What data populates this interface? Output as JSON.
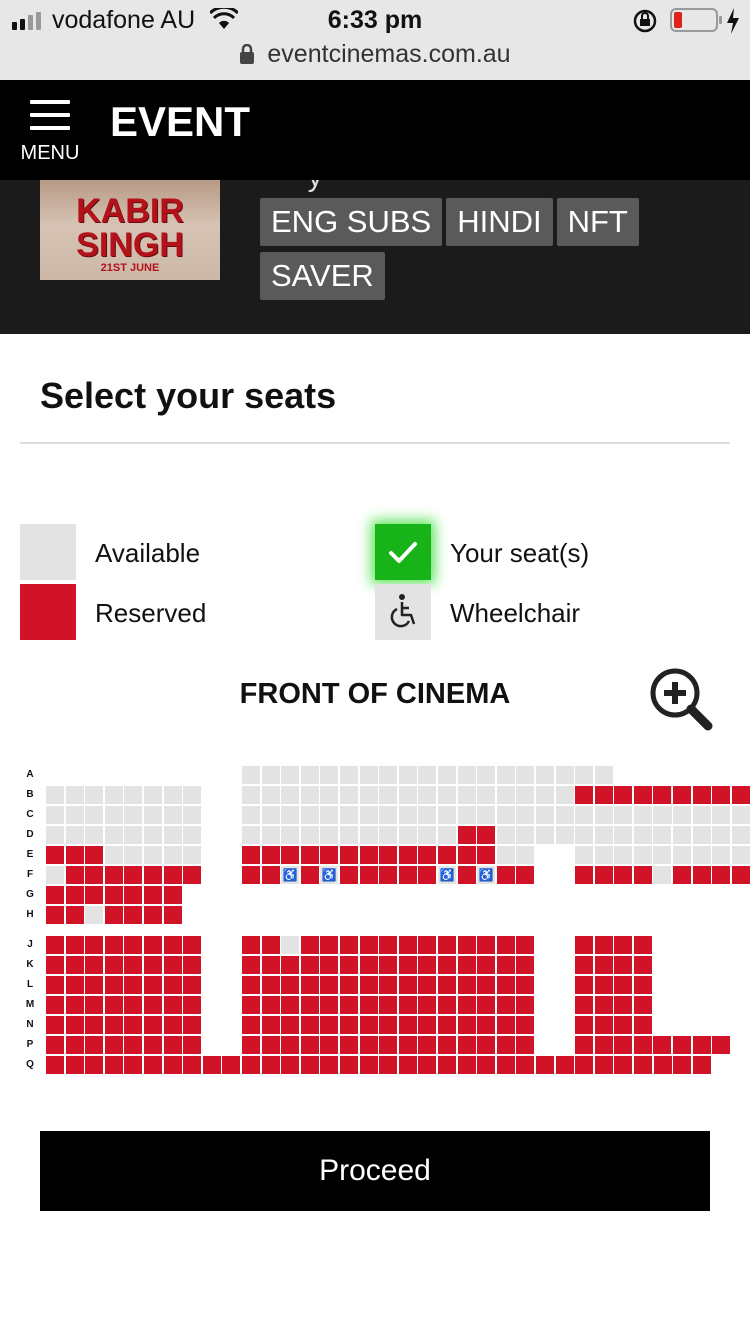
{
  "status_bar": {
    "carrier": "vodafone AU",
    "time": "6:33 pm",
    "url": "eventcinemas.com.au"
  },
  "nav": {
    "menu_label": "MENU",
    "logo": "EVENT"
  },
  "movie": {
    "poster_title_line1": "KABIR",
    "poster_title_line2": "SINGH",
    "poster_date": "21ST JUNE",
    "tags": [
      "ENG SUBS",
      "HINDI",
      "NFT",
      "SAVER"
    ]
  },
  "page": {
    "title": "Select your seats"
  },
  "legend": {
    "available": "Available",
    "your_seats": "Your seat(s)",
    "reserved": "Reserved",
    "wheelchair": "Wheelchair"
  },
  "screen_label": "FRONT OF CINEMA",
  "colors": {
    "reserved": "#d01326",
    "available": "#e3e3e3",
    "selected": "#18b318",
    "header": "#000000"
  },
  "seat_map": {
    "rows": [
      {
        "label": "A",
        "blocks": [
          "",
          "...................",
          ""
        ]
      },
      {
        "label": "B",
        "blocks": [
          "........",
          "..........................",
          "RRRRRRRRR"
        ]
      },
      {
        "label": "C",
        "blocks": [
          "........",
          "..........................",
          "........."
        ]
      },
      {
        "label": "D",
        "blocks": [
          "........",
          "...........RR.......",
          ".........."
        ]
      },
      {
        "label": "E",
        "blocks": [
          "RRR.....",
          "RRRRRRRRRRRRR..",
          ".........."
        ]
      },
      {
        "label": "F",
        "blocks": [
          ".RRRRRRR",
          "RRWRWRRRRRWRWRR",
          "RRRR.RRRRR"
        ]
      },
      {
        "label": "G",
        "blocks": [
          "RRRRRRR",
          "",
          ""
        ]
      },
      {
        "label": "H",
        "blocks": [
          "RR.RRRR",
          "",
          ""
        ]
      },
      {
        "label": "J",
        "blocks": [
          "RRRRRRRR",
          "RR.RRRRRRRRRRRR",
          "RRRR"
        ]
      },
      {
        "label": "K",
        "blocks": [
          "RRRRRRRR",
          "RRRRRRRRRRRRRRR",
          "RRRR"
        ]
      },
      {
        "label": "L",
        "blocks": [
          "RRRRRRRR",
          "RRRRRRRRRRRRRRR",
          "RRRR"
        ]
      },
      {
        "label": "M",
        "blocks": [
          "RRRRRRRR",
          "RRRRRRRRRRRRRRR",
          "RRRR"
        ]
      },
      {
        "label": "N",
        "blocks": [
          "RRRRRRRR",
          "RRRRRRRRRRRRRRR",
          "RRRR"
        ]
      },
      {
        "label": "P",
        "blocks": [
          "RRRRRRRR",
          "RRRRRRRRRRRRRRR",
          "RRRRRRRR"
        ]
      },
      {
        "label": "Q",
        "blocks": [
          "RRRRRRRRRR",
          "RRRRRRRRRRRRRRRRR",
          "RRRRRRRRR"
        ]
      }
    ]
  },
  "actions": {
    "proceed": "Proceed"
  }
}
